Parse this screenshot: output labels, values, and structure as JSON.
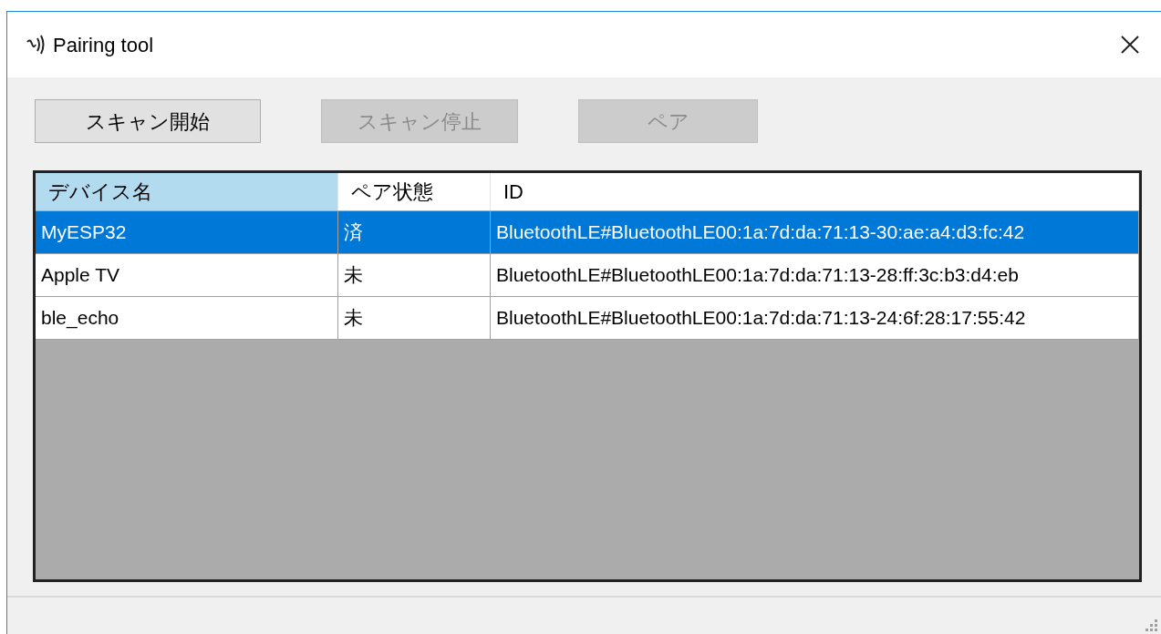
{
  "window": {
    "title": "Pairing tool"
  },
  "buttons": [
    {
      "label": "スキャン開始",
      "disabled": false
    },
    {
      "label": "スキャン停止",
      "disabled": true
    },
    {
      "label": "ペア",
      "disabled": true
    }
  ],
  "table": {
    "columns": [
      {
        "label": "デバイス名",
        "selected": true
      },
      {
        "label": "ペア状態",
        "selected": false
      },
      {
        "label": "ID",
        "selected": false
      }
    ],
    "rows": [
      {
        "selected": true,
        "cells": [
          "MyESP32",
          "済",
          "BluetoothLE#BluetoothLE00:1a:7d:da:71:13-30:ae:a4:d3:fc:42"
        ]
      },
      {
        "selected": false,
        "cells": [
          "Apple TV",
          "未",
          "BluetoothLE#BluetoothLE00:1a:7d:da:71:13-28:ff:3c:b3:d4:eb"
        ]
      },
      {
        "selected": false,
        "cells": [
          "ble_echo",
          "未",
          "BluetoothLE#BluetoothLE00:1a:7d:da:71:13-24:6f:28:17:55:42"
        ]
      }
    ]
  }
}
